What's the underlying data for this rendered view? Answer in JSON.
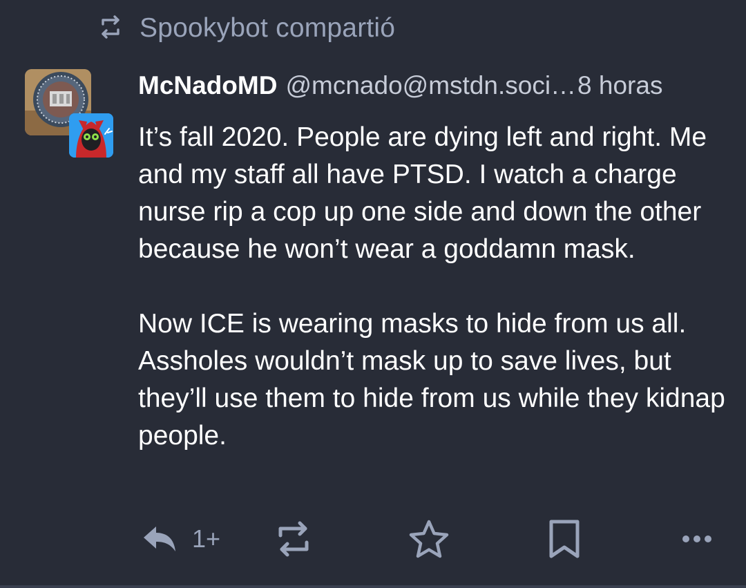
{
  "boost": {
    "label": "Spookybot compartió",
    "icon": "boost-icon"
  },
  "post": {
    "display_name": "McNadoMD",
    "handle": "@mcnado@mstdn.soci…",
    "time": "8 horas",
    "paragraphs": [
      "It’s fall 2020. People are dying left and right. Me and my staff all have PTSD. I watch a charge nurse rip a cop up one side and down the other because he won’t wear a goddamn mask.",
      "Now ICE is wearing masks to hide from us all. Assholes wouldn’t mask up to save lives, but they’ll use them to hide from us while they kidnap people."
    ]
  },
  "actions": {
    "reply_count": "1+",
    "icons": [
      "reply-icon",
      "boost-icon",
      "star-icon",
      "bookmark-icon",
      "more-icon"
    ]
  },
  "colors": {
    "background": "#282c37",
    "muted": "#9aa4ba",
    "text": "#ffffff"
  }
}
